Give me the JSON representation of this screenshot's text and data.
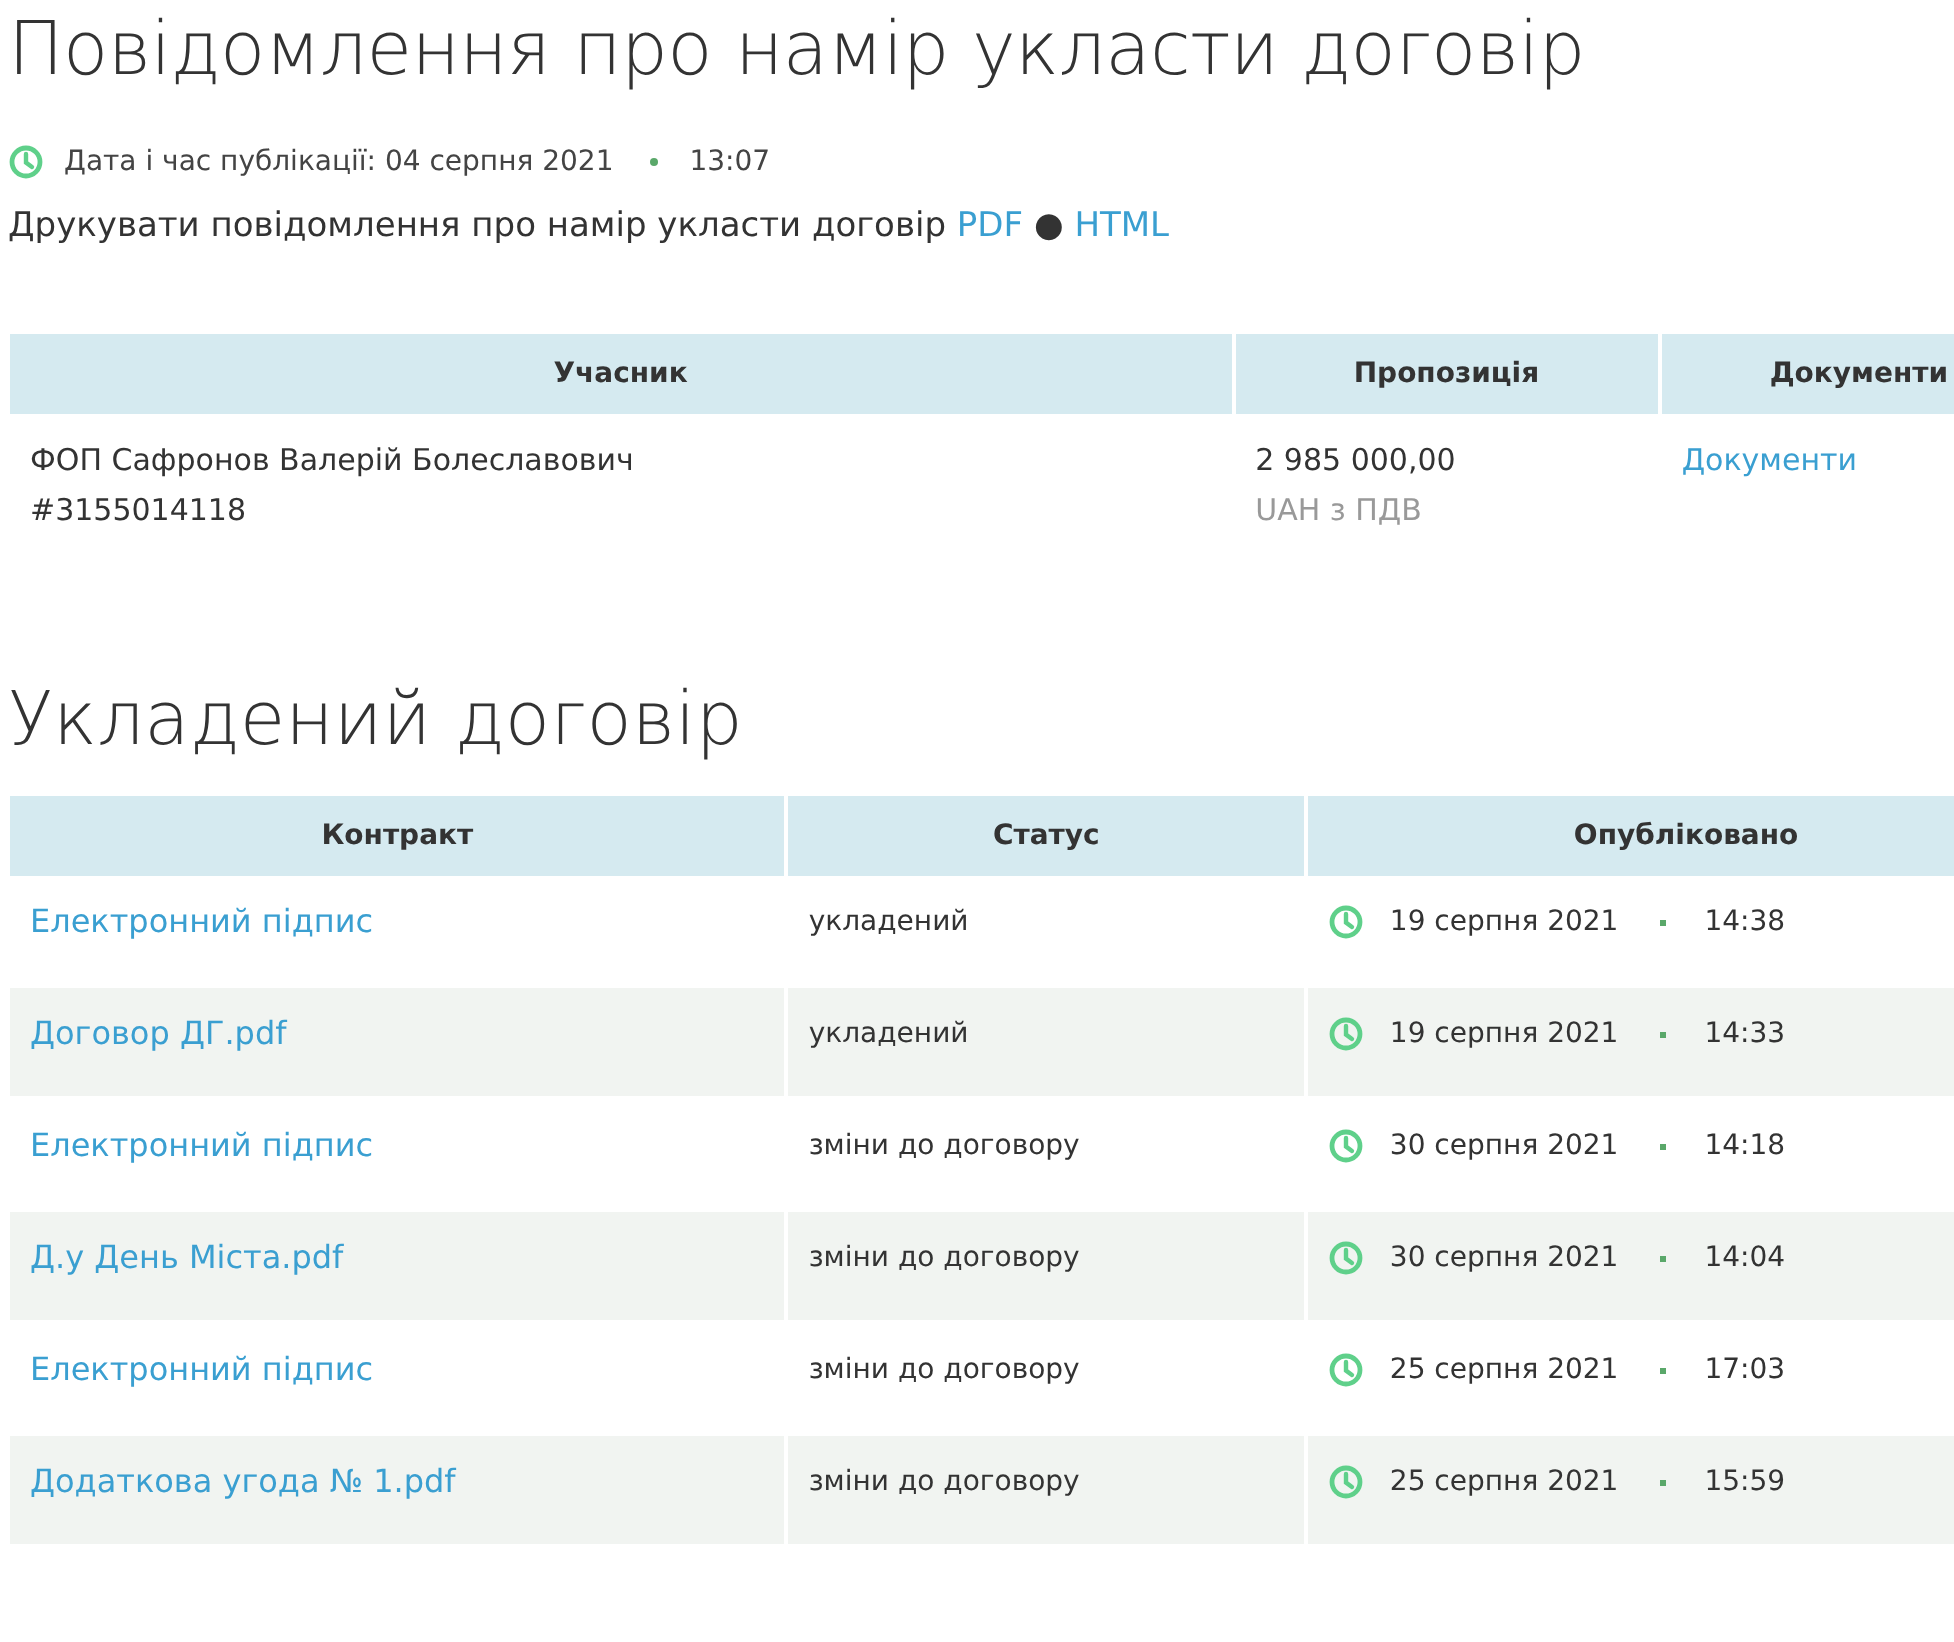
{
  "title": "Повідомлення про намір укласти договір",
  "publication": {
    "label": "Дата і час публікації: 04 серпня 2021",
    "time": "13:07"
  },
  "print": {
    "text": "Друкувати повідомлення про намір укласти договір",
    "links": [
      "PDF",
      "HTML"
    ],
    "separator": "●"
  },
  "bids_table": {
    "columns": [
      "Учасник",
      "Пропозиція",
      "Документи"
    ],
    "rows": [
      {
        "participant": "ФОП Сафронов Валерій Болеславович",
        "code": "#3155014118",
        "amount": "2 985 000,00",
        "currency": "UAH з ПДВ",
        "documents": "Документи"
      }
    ]
  },
  "contract_section": {
    "title": "Укладений договір"
  },
  "contracts_table": {
    "columns": [
      "Контракт",
      "Статус",
      "Опубліковано"
    ],
    "rows": [
      {
        "contract": "Електронний підпис",
        "status": "укладений",
        "date": "19 серпня 2021",
        "time": "14:38"
      },
      {
        "contract": "Договор ДГ.pdf",
        "status": "укладений",
        "date": "19 серпня 2021",
        "time": "14:33"
      },
      {
        "contract": "Електронний підпис",
        "status": "зміни до договору",
        "date": "30 серпня 2021",
        "time": "14:18"
      },
      {
        "contract": "Д.у День Міста.pdf",
        "status": "зміни до договору",
        "date": "30 серпня 2021",
        "time": "14:04"
      },
      {
        "contract": "Електронний підпис",
        "status": "зміни до договору",
        "date": "25 серпня 2021",
        "time": "17:03"
      },
      {
        "contract": "Додаткова угода № 1.pdf",
        "status": "зміни до договору",
        "date": "25 серпня 2021",
        "time": "15:59"
      }
    ]
  }
}
